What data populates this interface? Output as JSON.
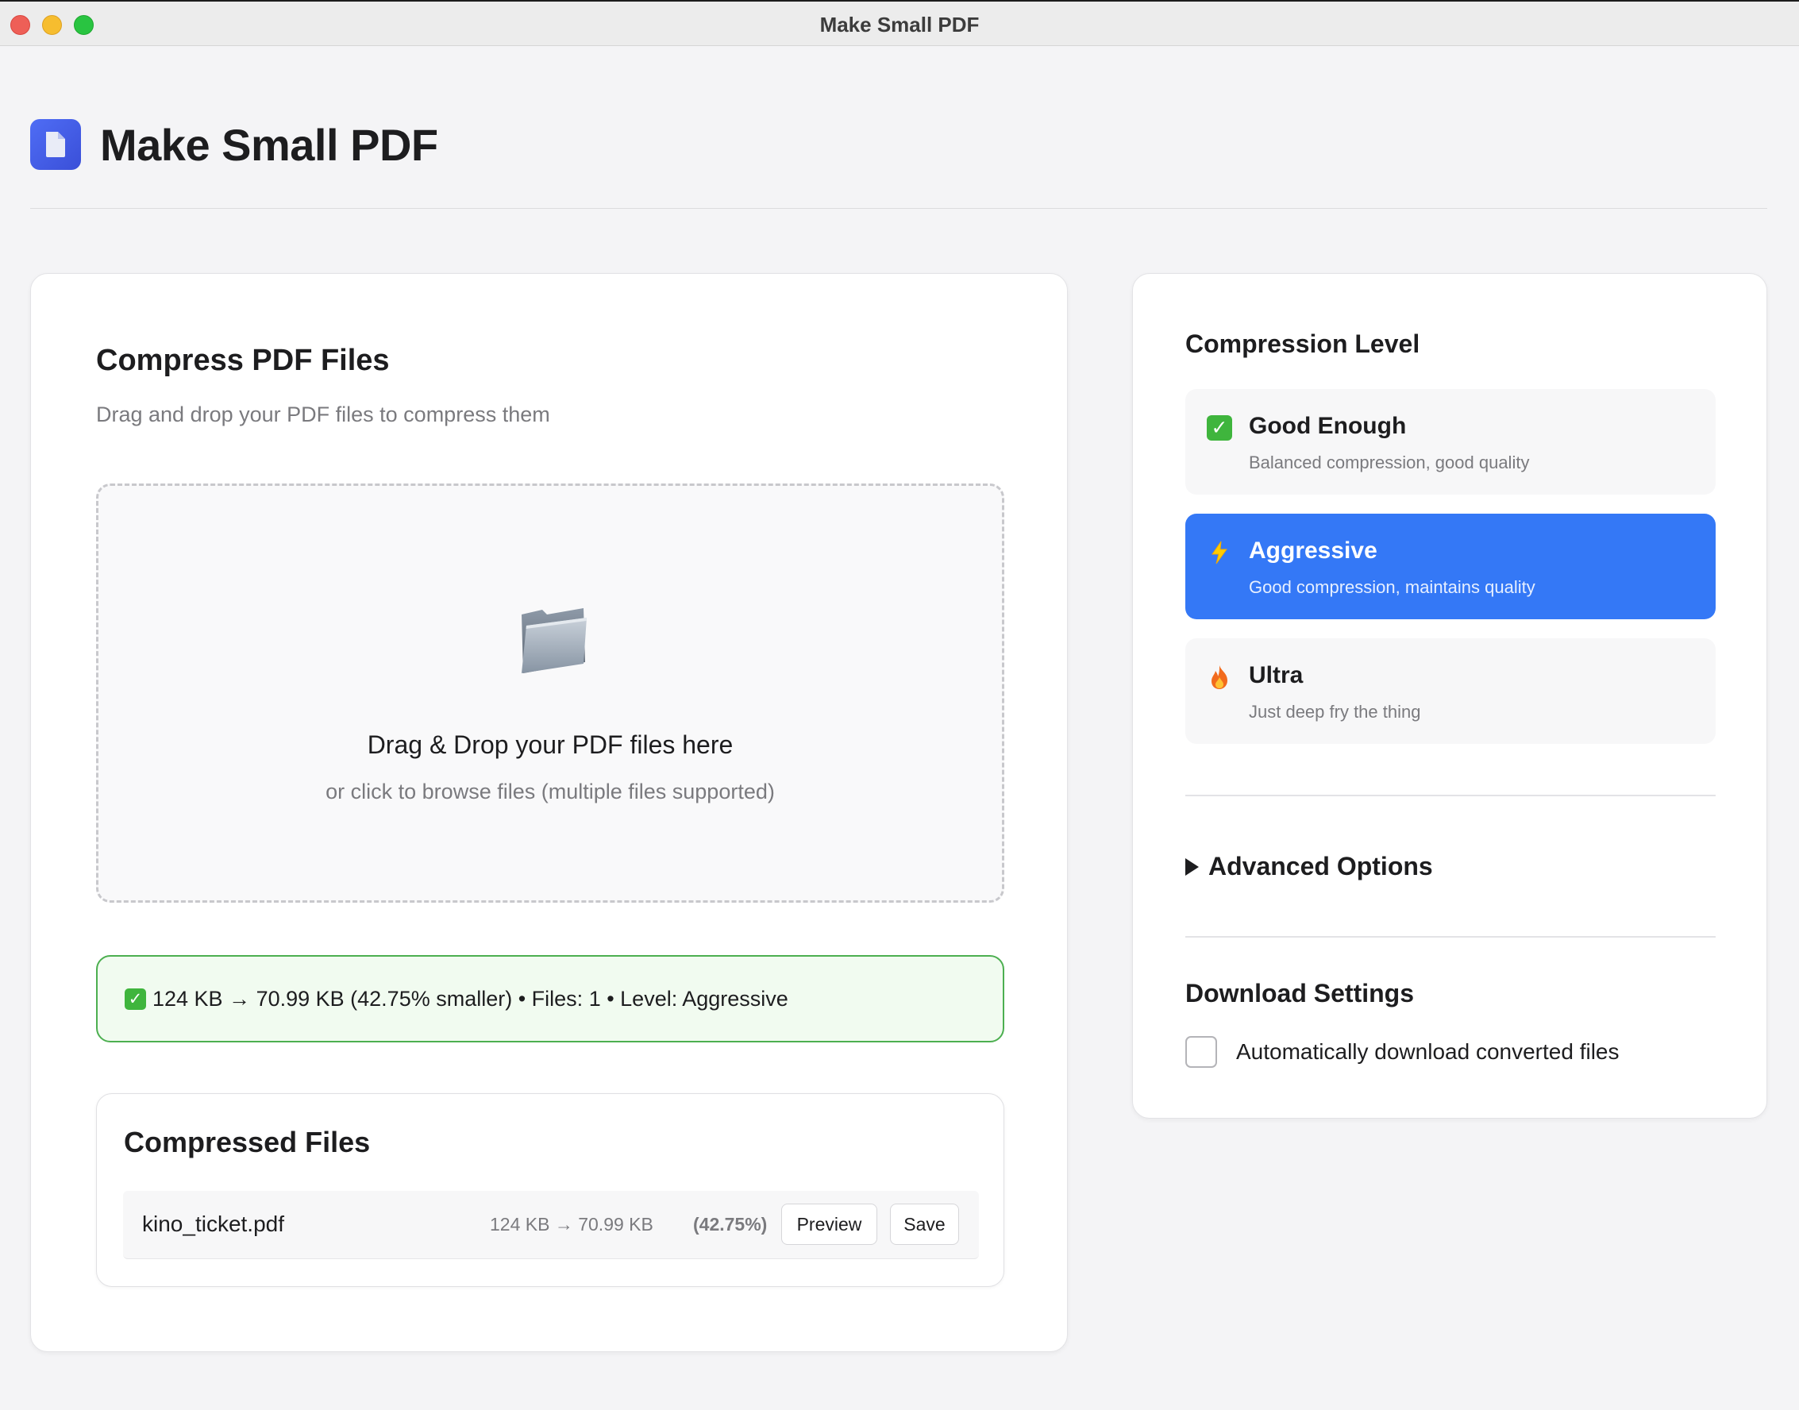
{
  "window": {
    "title": "Make Small PDF"
  },
  "header": {
    "title": "Make Small PDF"
  },
  "compress": {
    "title": "Compress PDF Files",
    "subtitle": "Drag and drop your PDF files to compress them",
    "dropzone_title": "Drag & Drop your PDF files here",
    "dropzone_subtitle": "or click to browse files (multiple files supported)"
  },
  "status": {
    "text": "124 KB → 70.99 KB (42.75% smaller) • Files: 1 • Level: Aggressive"
  },
  "compressed_files": {
    "title": "Compressed Files",
    "rows": [
      {
        "name": "kino_ticket.pdf",
        "sizes": "124 KB → 70.99 KB",
        "percent": "(42.75%)",
        "preview_label": "Preview",
        "save_label": "Save"
      }
    ]
  },
  "compression_level": {
    "title": "Compression Level",
    "selected": "Aggressive",
    "options": [
      {
        "title": "Good Enough",
        "description": "Balanced compression, good quality",
        "icon": "check-mark-icon"
      },
      {
        "title": "Aggressive",
        "description": "Good compression, maintains quality",
        "icon": "lightning-icon"
      },
      {
        "title": "Ultra",
        "description": "Just deep fry the thing",
        "icon": "fire-icon"
      }
    ]
  },
  "advanced": {
    "label": "Advanced Options"
  },
  "download": {
    "title": "Download Settings",
    "auto_download_label": "Automatically download converted files",
    "auto_download_checked": false
  },
  "colors": {
    "accent": "#3478f6",
    "success_border": "#4caf50",
    "success_bg": "#f1fbf0",
    "logo": "#4f6df5"
  }
}
